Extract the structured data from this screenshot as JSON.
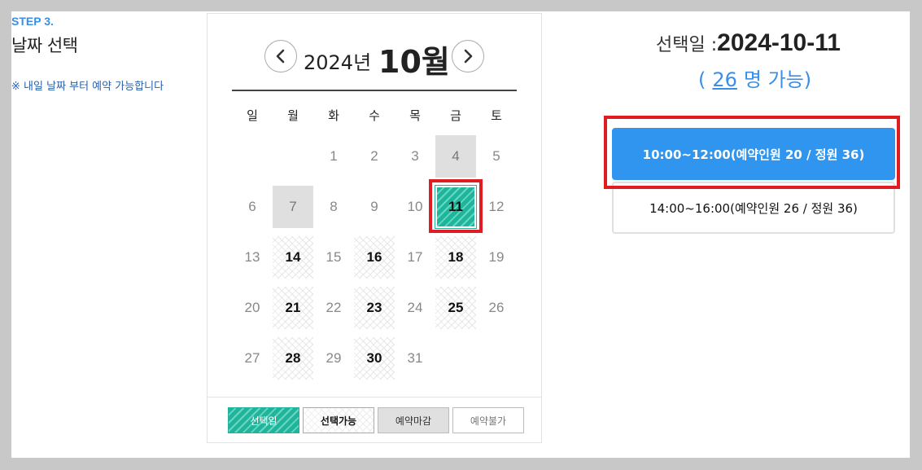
{
  "step": {
    "label": "STEP 3.",
    "title": "날짜 선택",
    "note": "※ 내일 날짜 부터 예약 가능합니다"
  },
  "calendar": {
    "year_label": "2024년",
    "month_label": "10월",
    "prev_icon": "chevron-left-icon",
    "next_icon": "chevron-right-icon",
    "weekdays": [
      "일",
      "월",
      "화",
      "수",
      "목",
      "금",
      "토"
    ],
    "weeks": [
      [
        {
          "d": ""
        },
        {
          "d": ""
        },
        {
          "d": "1",
          "s": "none"
        },
        {
          "d": "2",
          "s": "none"
        },
        {
          "d": "3",
          "s": "none"
        },
        {
          "d": "4",
          "s": "closed"
        },
        {
          "d": "5",
          "s": "none"
        }
      ],
      [
        {
          "d": "6",
          "s": "none"
        },
        {
          "d": "7",
          "s": "closed"
        },
        {
          "d": "8",
          "s": "none"
        },
        {
          "d": "9",
          "s": "none"
        },
        {
          "d": "10",
          "s": "none"
        },
        {
          "d": "11",
          "s": "selected"
        },
        {
          "d": "12",
          "s": "none"
        }
      ],
      [
        {
          "d": "13",
          "s": "none"
        },
        {
          "d": "14",
          "s": "available"
        },
        {
          "d": "15",
          "s": "none"
        },
        {
          "d": "16",
          "s": "available"
        },
        {
          "d": "17",
          "s": "none"
        },
        {
          "d": "18",
          "s": "available"
        },
        {
          "d": "19",
          "s": "none"
        }
      ],
      [
        {
          "d": "20",
          "s": "none"
        },
        {
          "d": "21",
          "s": "available"
        },
        {
          "d": "22",
          "s": "none"
        },
        {
          "d": "23",
          "s": "available"
        },
        {
          "d": "24",
          "s": "none"
        },
        {
          "d": "25",
          "s": "available"
        },
        {
          "d": "26",
          "s": "none"
        }
      ],
      [
        {
          "d": "27",
          "s": "none"
        },
        {
          "d": "28",
          "s": "available"
        },
        {
          "d": "29",
          "s": "none"
        },
        {
          "d": "30",
          "s": "available"
        },
        {
          "d": "31",
          "s": "none"
        },
        {
          "d": ""
        },
        {
          "d": ""
        }
      ]
    ],
    "legend": {
      "selected": "선택일",
      "available": "선택가능",
      "closed": "예약마감",
      "unavailable": "예약불가"
    }
  },
  "selection": {
    "date_prefix": "선택일 :",
    "date": "2024-10-11",
    "capacity_open": "(",
    "capacity_count": "26",
    "capacity_text": "명 가능)"
  },
  "slots": [
    {
      "label": "10:00~12:00(예약인원 20 / 정원 36)",
      "active": true
    },
    {
      "label": "14:00~16:00(예약인원 26 / 정원 36)",
      "active": false
    }
  ],
  "colors": {
    "accent_blue": "#2f95ee",
    "selected_teal": "#1fb59c",
    "highlight_red": "#e11b22"
  }
}
